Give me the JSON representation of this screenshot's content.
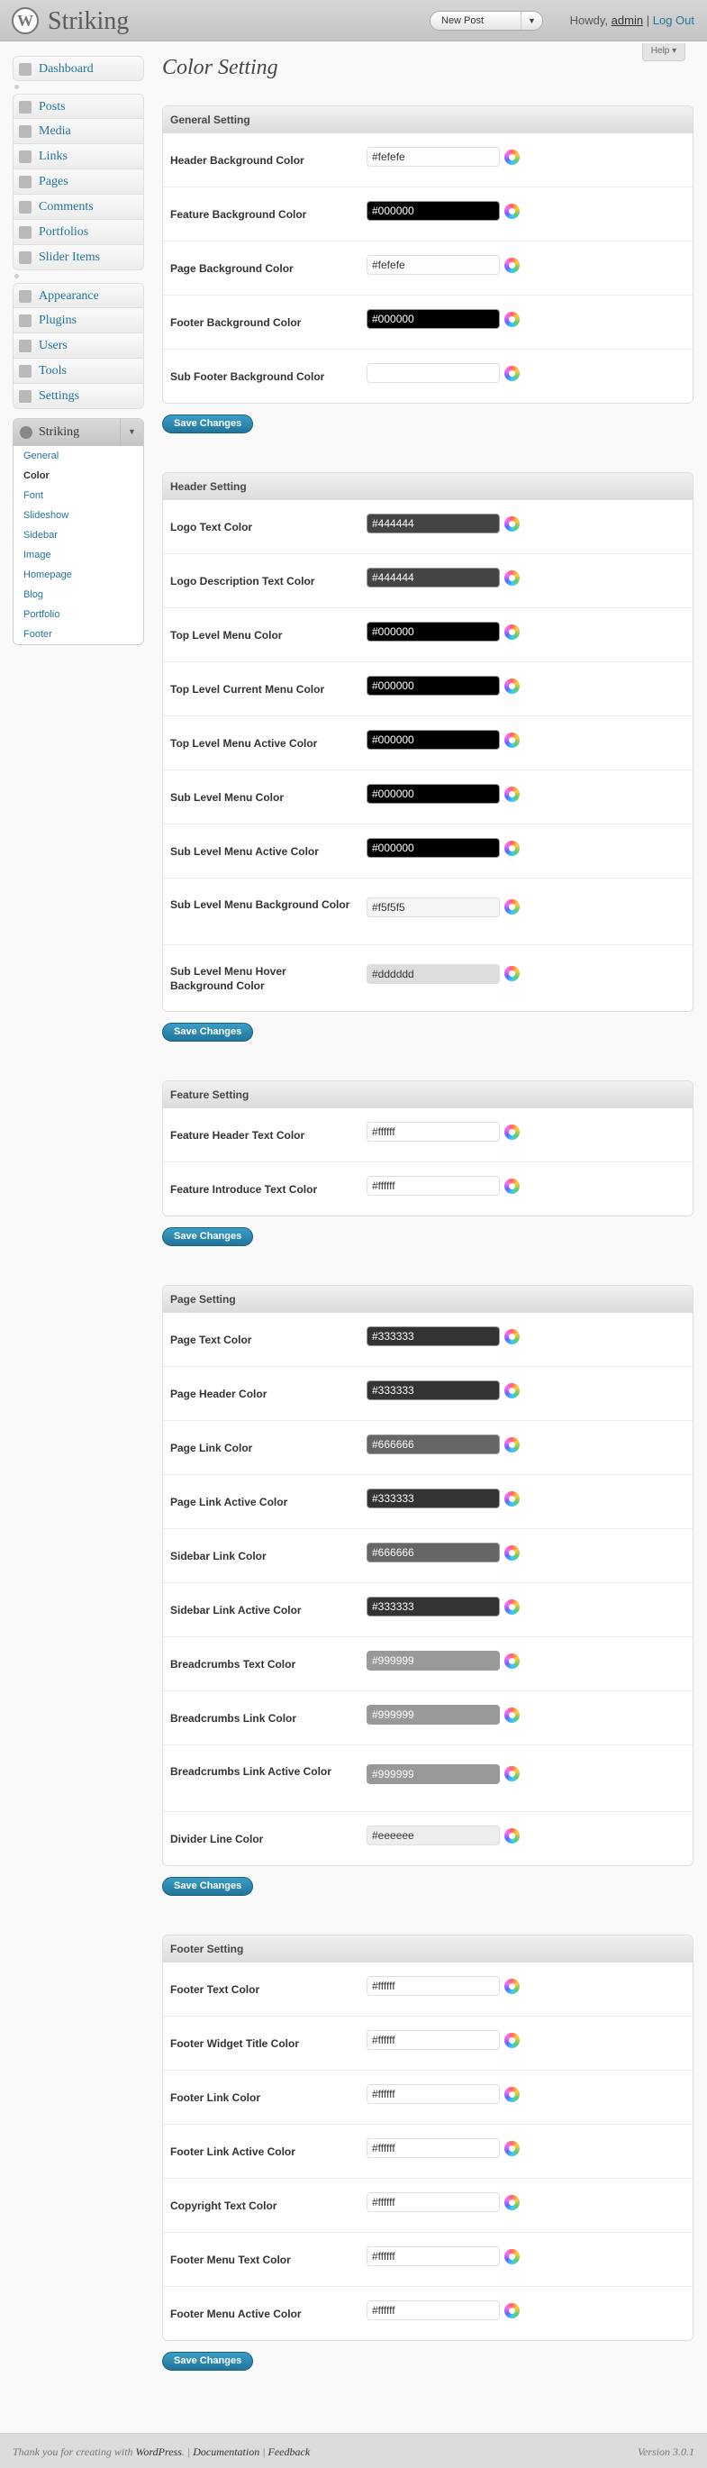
{
  "header": {
    "site_title": "Striking",
    "favorite_action": "New Post",
    "howdy": "Howdy,",
    "user": "admin",
    "separator": "|",
    "logout": "Log Out",
    "help": "Help"
  },
  "menu": {
    "dashboard": "Dashboard",
    "content": [
      "Posts",
      "Media",
      "Links",
      "Pages",
      "Comments",
      "Portfolios",
      "Slider Items"
    ],
    "admin": [
      "Appearance",
      "Plugins",
      "Users",
      "Tools",
      "Settings"
    ],
    "striking": {
      "title": "Striking",
      "items": [
        "General",
        "Color",
        "Font",
        "Slideshow",
        "Sidebar",
        "Image",
        "Homepage",
        "Blog",
        "Portfolio",
        "Footer"
      ],
      "current": "Color"
    }
  },
  "page": {
    "title": "Color Setting",
    "save_label": "Save Changes"
  },
  "sections": [
    {
      "title": "General Setting",
      "rows": [
        {
          "label": "Header Background Color",
          "value": "#fefefe",
          "color": "#fefefe"
        },
        {
          "label": "Feature Background Color",
          "value": "#000000",
          "color": "#000000"
        },
        {
          "label": "Page Background Color",
          "value": "#fefefe",
          "color": "#fefefe"
        },
        {
          "label": "Footer Background Color",
          "value": "#000000",
          "color": "#000000"
        },
        {
          "label": "Sub Footer Background Color",
          "value": "",
          "color": "#ffffff"
        }
      ]
    },
    {
      "title": "Header Setting",
      "rows": [
        {
          "label": "Logo Text Color",
          "value": "#444444",
          "color": "#444444"
        },
        {
          "label": "Logo Description Text Color",
          "value": "#444444",
          "color": "#444444"
        },
        {
          "label": "Top Level Menu Color",
          "value": "#000000",
          "color": "#000000"
        },
        {
          "label": "Top Level Current Menu Color",
          "value": "#000000",
          "color": "#000000"
        },
        {
          "label": "Top Level Menu Active Color",
          "value": "#000000",
          "color": "#000000"
        },
        {
          "label": "Sub Level Menu Color",
          "value": "#000000",
          "color": "#000000"
        },
        {
          "label": "Sub Level Menu Active Color",
          "value": "#000000",
          "color": "#000000"
        },
        {
          "label": "Sub Level Menu Background Color",
          "value": "#f5f5f5",
          "color": "#f5f5f5"
        },
        {
          "label": "Sub Level Menu Hover Background Color",
          "value": "#dddddd",
          "color": "#dddddd"
        }
      ]
    },
    {
      "title": "Feature Setting",
      "rows": [
        {
          "label": "Feature Header Text Color",
          "value": "#ffffff",
          "color": "#ffffff"
        },
        {
          "label": "Feature Introduce Text Color",
          "value": "#ffffff",
          "color": "#ffffff"
        }
      ]
    },
    {
      "title": "Page Setting",
      "rows": [
        {
          "label": "Page Text Color",
          "value": "#333333",
          "color": "#333333"
        },
        {
          "label": "Page Header Color",
          "value": "#333333",
          "color": "#333333"
        },
        {
          "label": "Page Link Color",
          "value": "#666666",
          "color": "#666666"
        },
        {
          "label": "Page Link Active Color",
          "value": "#333333",
          "color": "#333333"
        },
        {
          "label": "Sidebar Link Color",
          "value": "#666666",
          "color": "#666666"
        },
        {
          "label": "Sidebar Link Active Color",
          "value": "#333333",
          "color": "#333333"
        },
        {
          "label": "Breadcrumbs Text Color",
          "value": "#999999",
          "color": "#999999"
        },
        {
          "label": "Breadcrumbs Link Color",
          "value": "#999999",
          "color": "#999999"
        },
        {
          "label": "Breadcrumbs Link Active Color",
          "value": "#999999",
          "color": "#999999"
        },
        {
          "label": "Divider Line Color",
          "value": "#eeeeee",
          "color": "#eeeeee"
        }
      ]
    },
    {
      "title": "Footer Setting",
      "rows": [
        {
          "label": "Footer Text Color",
          "value": "#ffffff",
          "color": "#ffffff"
        },
        {
          "label": "Footer Widget Title Color",
          "value": "#ffffff",
          "color": "#ffffff"
        },
        {
          "label": "Footer Link Color",
          "value": "#ffffff",
          "color": "#ffffff"
        },
        {
          "label": "Footer Link Active Color",
          "value": "#ffffff",
          "color": "#ffffff"
        },
        {
          "label": "Copyright Text Color",
          "value": "#ffffff",
          "color": "#ffffff"
        },
        {
          "label": "Footer Menu Text Color",
          "value": "#ffffff",
          "color": "#ffffff"
        },
        {
          "label": "Footer Menu Active Color",
          "value": "#ffffff",
          "color": "#ffffff"
        }
      ]
    }
  ],
  "footer": {
    "thanks_prefix": "Thank you for creating with",
    "wordpress": "WordPress",
    "documentation": "Documentation",
    "feedback": "Feedback",
    "version": "Version 3.0.1"
  }
}
